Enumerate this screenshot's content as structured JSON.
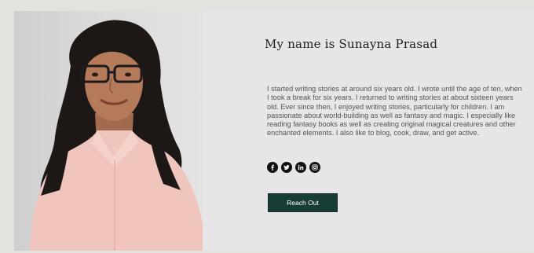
{
  "profile": {
    "heading": "My name is Sunayna Prasad",
    "bio": "I started writing stories at around six years old. I wrote until the age of ten, when I took a break for six years. I returned to writing stories at about sixteen years old. Ever since then, I enjoyed writing stories, particularly for children. I am passionate about world-building as well as fantasy and magic. I especially like reading fantasy books as well as creating original magical creatures and other enchanted elements. I also like to blog, cook, draw, and get active.",
    "reach_out_label": "Reach Out"
  },
  "social": [
    {
      "name": "facebook",
      "icon": "facebook-icon"
    },
    {
      "name": "twitter",
      "icon": "twitter-icon"
    },
    {
      "name": "linkedin",
      "icon": "linkedin-icon"
    },
    {
      "name": "instagram",
      "icon": "instagram-icon"
    }
  ],
  "colors": {
    "page_background": "#e4e2dd",
    "panel_background": "#e7e5e7",
    "button_background": "#173d36",
    "icon_color": "#111111"
  }
}
